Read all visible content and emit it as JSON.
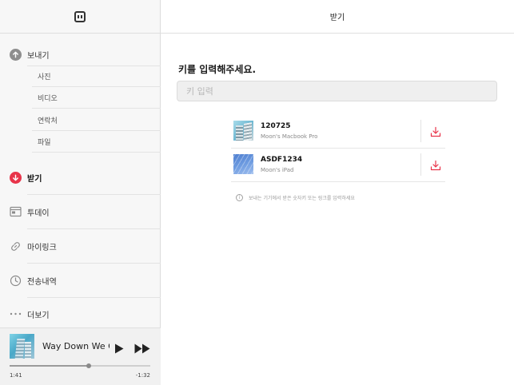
{
  "sidebar": {
    "logo": "app-logo-icon",
    "items": [
      {
        "label": "보내기",
        "icon": "arrow-up-circle-icon"
      },
      {
        "label": "받기",
        "icon": "arrow-down-circle-icon",
        "active": true
      },
      {
        "label": "투데이",
        "icon": "calendar-icon"
      },
      {
        "label": "마이링크",
        "icon": "link-icon"
      },
      {
        "label": "전송내역",
        "icon": "clock-icon"
      },
      {
        "label": "더보기",
        "icon": "more-icon"
      }
    ],
    "send_subitems": [
      "사진",
      "비디오",
      "연락처",
      "파일"
    ]
  },
  "player": {
    "track_title": "Way Down We Go",
    "elapsed": "1:41",
    "remaining": "-1:32",
    "progress": 0.56
  },
  "main": {
    "title": "받기",
    "prompt": "키를 입력해주세요.",
    "key_input": {
      "value": "",
      "placeholder": "키 입력"
    },
    "devices": [
      {
        "key": "120725",
        "device": "Moon's Macbook Pro"
      },
      {
        "key": "ASDF1234",
        "device": "Moon's iPad"
      }
    ],
    "info_text": "보내는 기기에서 받은 숫자키 또는 링크를 입력하세요"
  },
  "colors": {
    "accent": "#e8344a",
    "sidebar_bg": "#f7f7f7",
    "icon_gray": "#8a8a8a"
  }
}
